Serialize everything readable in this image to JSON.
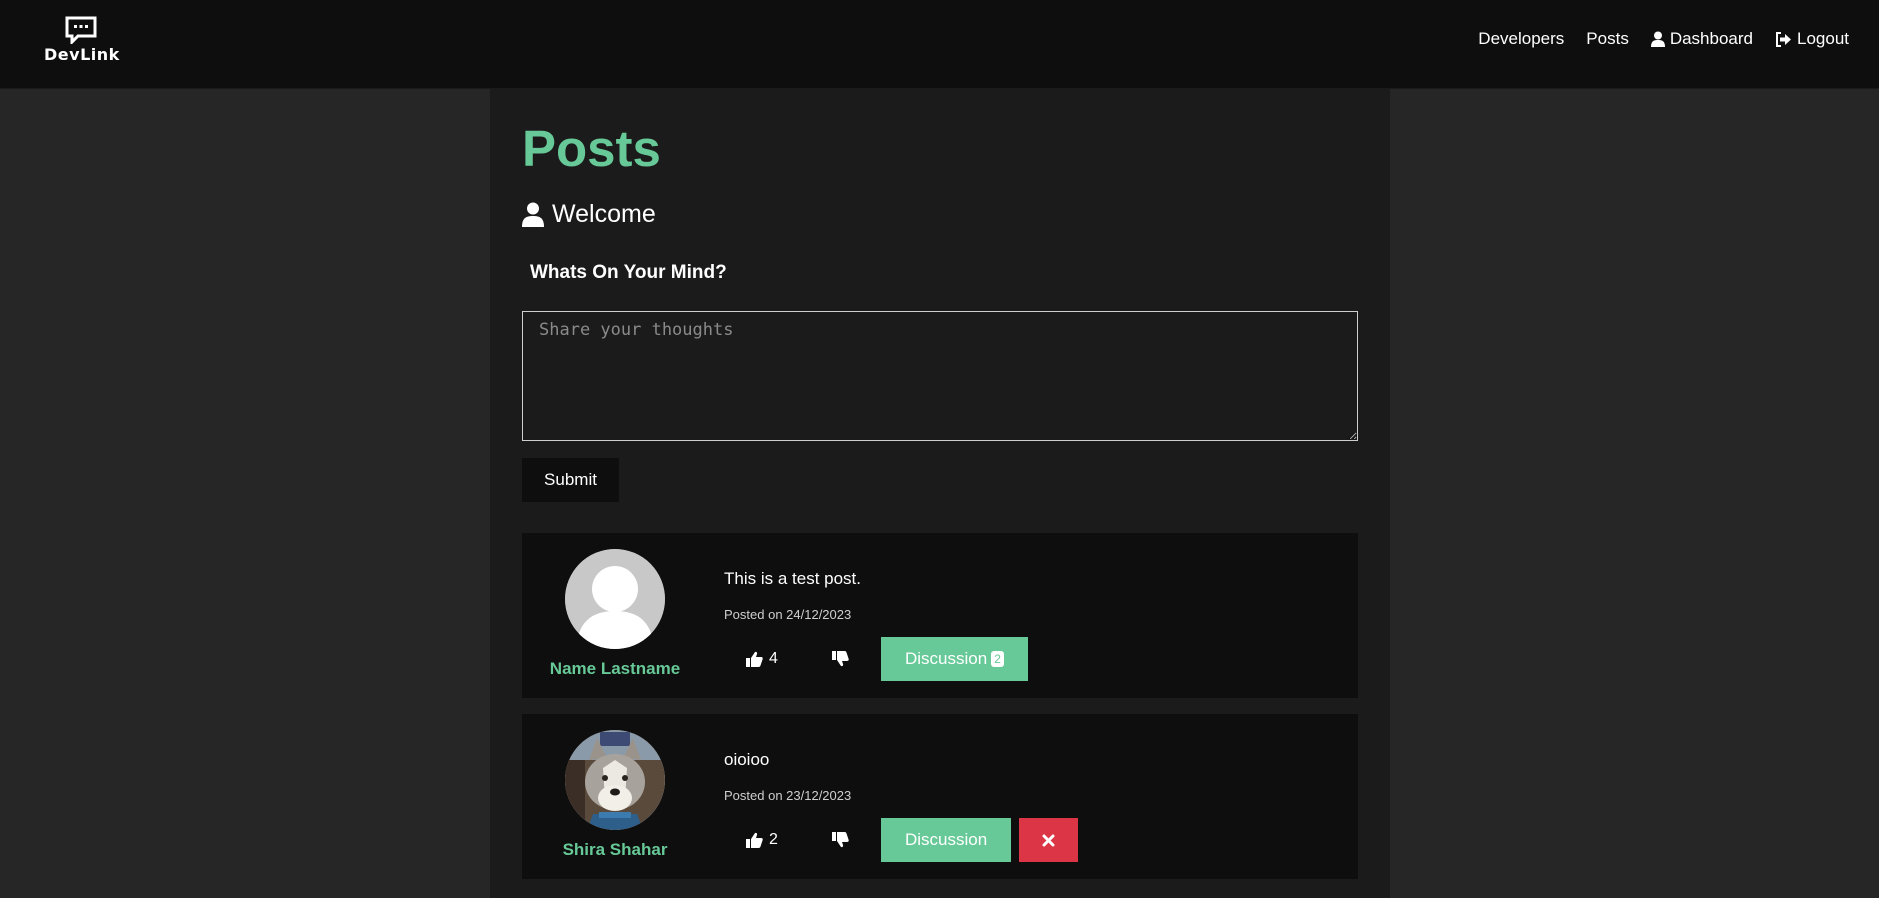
{
  "app": {
    "logo_text": "DevLink"
  },
  "nav": {
    "developers": "Developers",
    "posts": "Posts",
    "dashboard": "Dashboard",
    "logout": "Logout"
  },
  "page": {
    "title": "Posts",
    "welcome": "Welcome",
    "prompt_heading": "Whats On Your Mind?",
    "textarea_placeholder": "Share your thoughts",
    "submit_label": "Submit"
  },
  "posts": [
    {
      "author": "Name Lastname",
      "text": "This is a test post.",
      "date": "Posted on 24/12/2023",
      "likes": "4",
      "discussion_label": "Discussion",
      "comment_count": "2",
      "avatar": "default-user-avatar"
    },
    {
      "author": "Shira Shahar",
      "text": "oioioo",
      "date": "Posted on 23/12/2023",
      "likes": "2",
      "discussion_label": "Discussion",
      "avatar": "husky-dog-photo"
    }
  ],
  "colors": {
    "accent": "#67c997",
    "danger": "#dc3545",
    "navbar_bg": "#0e0e0e",
    "page_bg": "#262626",
    "container_bg": "#1c1b1c"
  }
}
